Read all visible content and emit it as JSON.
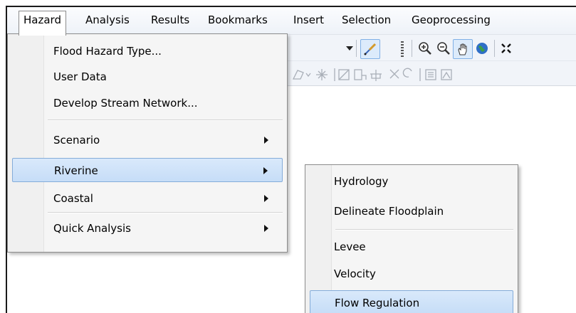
{
  "menubar": {
    "items": [
      {
        "label": "Hazard"
      },
      {
        "label": "Analysis"
      },
      {
        "label": "Results"
      },
      {
        "label": "Bookmarks"
      },
      {
        "label": "Insert"
      },
      {
        "label": "Selection"
      },
      {
        "label": "Geoprocessing"
      }
    ]
  },
  "hazard_menu": {
    "items": [
      {
        "label": "Flood Hazard Type..."
      },
      {
        "label": "User Data"
      },
      {
        "label": "Develop Stream Network..."
      },
      {
        "label": "Scenario",
        "has_submenu": true
      },
      {
        "label": "Riverine",
        "has_submenu": true,
        "highlighted": true
      },
      {
        "label": "Coastal",
        "has_submenu": true
      },
      {
        "label": "Quick Analysis",
        "has_submenu": true
      }
    ]
  },
  "riverine_submenu": {
    "items": [
      {
        "label": "Hydrology"
      },
      {
        "label": "Delineate Floodplain"
      },
      {
        "label": "Levee"
      },
      {
        "label": "Velocity"
      },
      {
        "label": "Flow Regulation",
        "highlighted": true
      }
    ]
  },
  "toolbar": {
    "icons": [
      "dropdown-arrow-icon",
      "edit-tool-icon",
      "zoom-in-icon",
      "zoom-out-icon",
      "pan-hand-icon",
      "globe-icon",
      "full-extent-icon"
    ]
  },
  "colors": {
    "highlight_bg": "#c6ddf7",
    "highlight_border": "#84acd9",
    "menu_bg": "#f5f5f5"
  }
}
